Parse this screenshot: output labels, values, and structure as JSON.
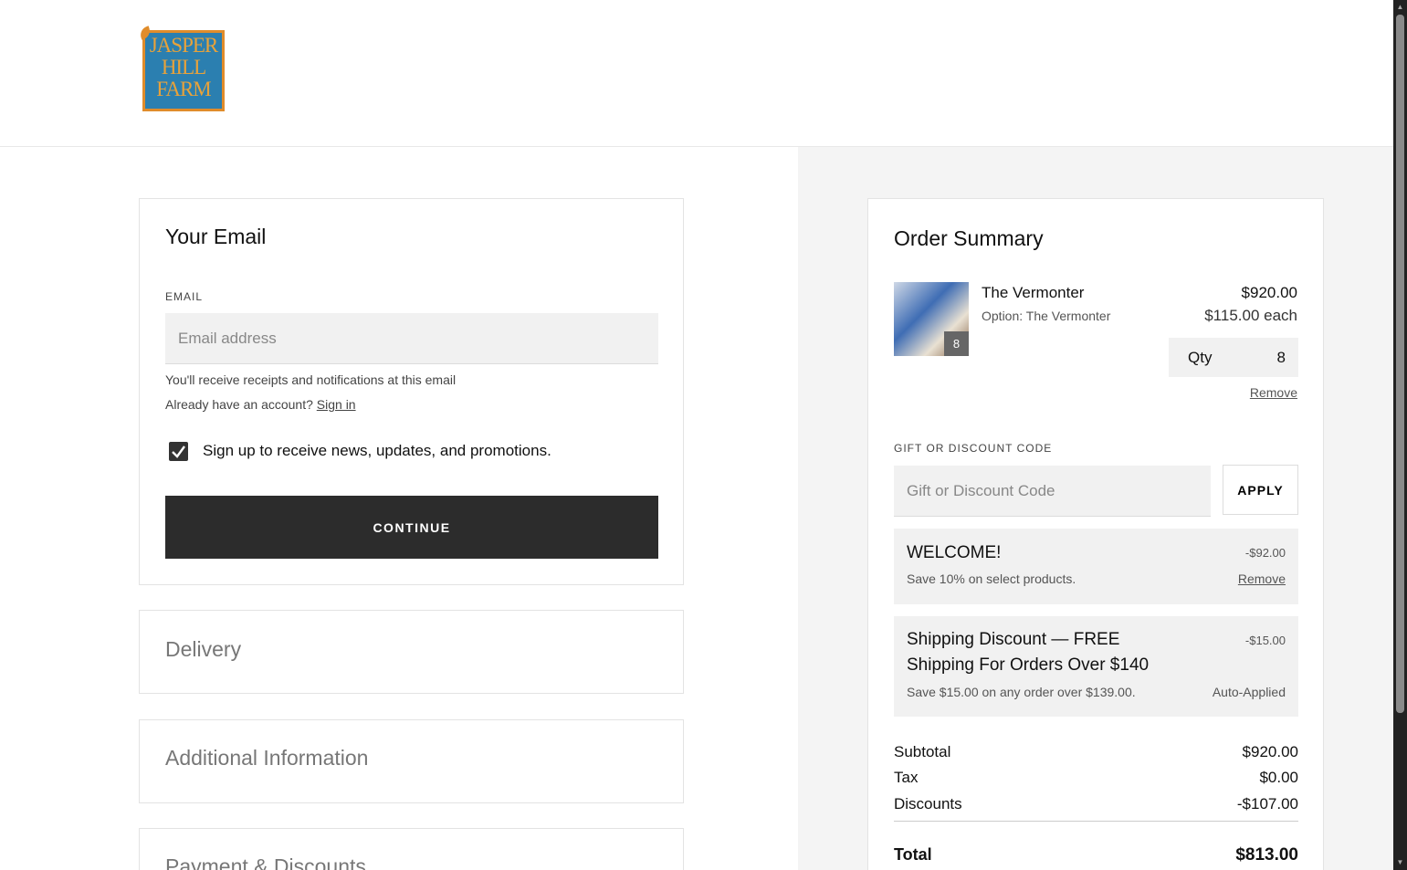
{
  "brand": {
    "logo_text": "JASPER HILL FARM",
    "logo_lines": [
      "JASPER",
      "HILL",
      "FARM"
    ]
  },
  "email_section": {
    "title": "Your Email",
    "email_label": "EMAIL",
    "email_placeholder": "Email address",
    "email_value": "",
    "hint": "You'll receive receipts and notifications at this email",
    "account_prompt": "Already have an account?",
    "sign_in": "Sign in",
    "newsletter_label": "Sign up to receive news, updates, and promotions.",
    "newsletter_checked": true,
    "continue_button": "CONTINUE"
  },
  "sections": [
    {
      "title": "Delivery"
    },
    {
      "title": "Additional Information"
    },
    {
      "title": "Payment & Discounts"
    }
  ],
  "summary": {
    "title": "Order Summary",
    "item": {
      "name": "The Vermonter",
      "option": "Option: The Vermonter",
      "quantity_badge": "8",
      "price": "$920.00",
      "each": "$115.00 each",
      "qty_label": "Qty",
      "qty_value": "8",
      "remove": "Remove"
    },
    "gift_label": "GIFT OR DISCOUNT CODE",
    "gift_placeholder": "Gift or Discount Code",
    "apply_button": "APPLY",
    "discounts": [
      {
        "title": "WELCOME!",
        "desc": "Save 10% on select products.",
        "amount": "-$92.00",
        "action": "Remove"
      },
      {
        "title_line1": "Shipping Discount — FREE",
        "title_line2": "Shipping For Orders Over $140",
        "desc": "Save $15.00 on any order over $139.00.",
        "amount": "-$15.00",
        "action": "Auto-Applied"
      }
    ],
    "subtotal_label": "Subtotal",
    "subtotal": "$920.00",
    "tax_label": "Tax",
    "tax": "$0.00",
    "discounts_label": "Discounts",
    "discounts_total": "-$107.00",
    "total_label": "Total",
    "total": "$813.00"
  },
  "colors": {
    "logo_blue": "#2b7fb0",
    "logo_orange": "#e08c2b",
    "button_dark": "#2c2c2c",
    "panel_gray": "#f4f4f4"
  }
}
